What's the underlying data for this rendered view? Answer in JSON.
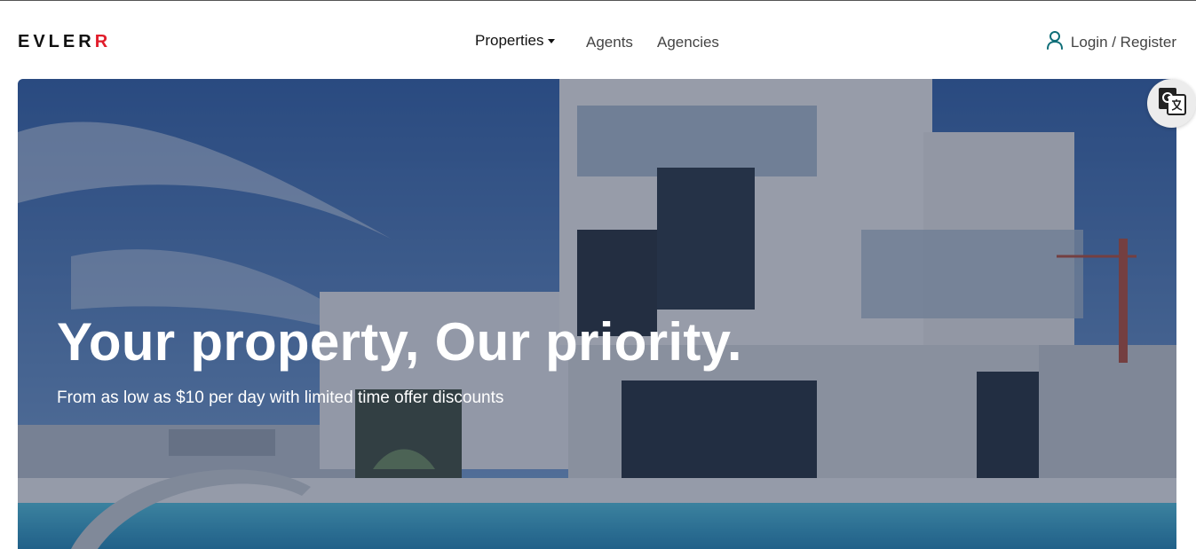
{
  "brand": {
    "logo_main": "EVLER",
    "logo_accent": "R",
    "accent_color": "#e11d2b"
  },
  "nav": {
    "items": [
      {
        "label": "Properties",
        "has_dropdown": true
      },
      {
        "label": "Agents"
      },
      {
        "label": "Agencies"
      }
    ]
  },
  "auth": {
    "label": "Login / Register",
    "icon": "user-icon",
    "icon_color": "#0f6e78"
  },
  "hero": {
    "title": "Your property, Our priority.",
    "subtitle": "From as low as $10 per day with limited time offer discounts"
  },
  "translate_widget": {
    "icon": "google-translate-icon"
  }
}
